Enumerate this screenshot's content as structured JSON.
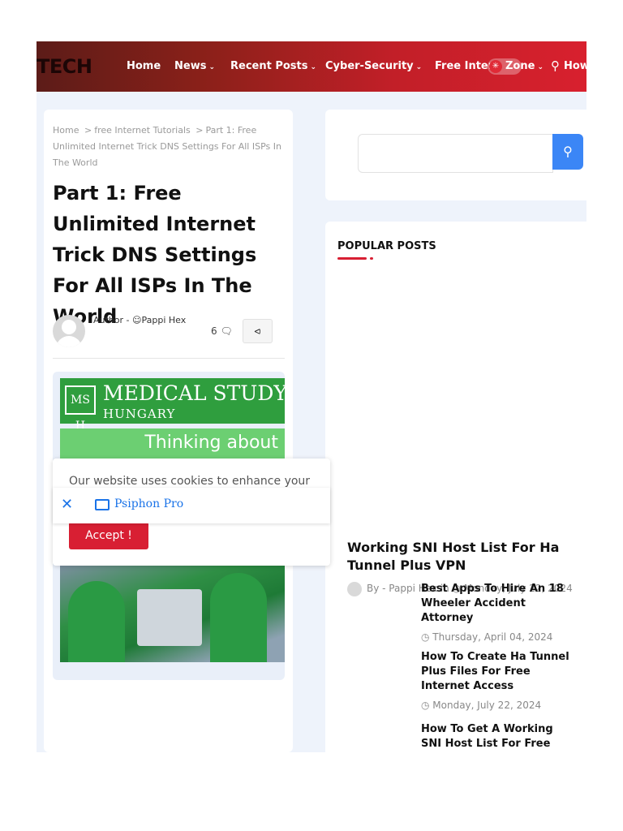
{
  "nav": {
    "brand": "TECH",
    "items": [
      {
        "label": "Home",
        "chevron": false
      },
      {
        "label": "News",
        "chevron": true
      },
      {
        "label": "Recent Posts",
        "chevron": true
      },
      {
        "label": "Cyber-Security",
        "chevron": true
      },
      {
        "label": "Free Intern",
        "chevron": false
      },
      {
        "label": "Zone",
        "chevron": true
      },
      {
        "label": "How",
        "chevron": false
      }
    ]
  },
  "breadcrumb": {
    "home": "Home",
    "category": "free Internet Tutorials",
    "current": "Part 1: Free Unlimited Internet Trick DNS Settings For All ISPs In The World",
    "separator": ">"
  },
  "post": {
    "title": "Part 1: Free Unlimited Internet Trick DNS Settings For All ISPs In The World",
    "author_prefix": "Author -",
    "author_name": "Pappi Hex",
    "comment_count": "6"
  },
  "ad": {
    "logo_text": "MS H",
    "headline": "MEDICAL STUDY",
    "subheadline": "HUNGARY",
    "tagline": "Thinking about"
  },
  "cookie": {
    "text": "Our website uses cookies to enhance your",
    "accept_label": "Accept !"
  },
  "psiphon": {
    "label": "Psiphon Pro"
  },
  "sidebar": {
    "popular_heading": "POPULAR POSTS",
    "featured": {
      "title": "Working SNI Host List For Ha Tunnel Plus VPN",
      "meta": "By - Pappi Hex in ◷ Monday, July 22, 2024"
    },
    "posts": [
      {
        "title": "Best Apps To Hire An 18 Wheeler Accident Attorney",
        "date": "◷ Thursday, April 04, 2024"
      },
      {
        "title": "How To Create Ha Tunnel Plus Files For Free Internet Access",
        "date": "◷ Monday, July 22, 2024"
      },
      {
        "title": "How To Get A Working SNI Host List For Free Internet",
        "date": ""
      }
    ]
  },
  "colors": {
    "accent": "#d81f33",
    "search_button": "#3b86f6",
    "nav_gradient_start": "#5c1c18",
    "nav_gradient_end": "#d8202e"
  }
}
